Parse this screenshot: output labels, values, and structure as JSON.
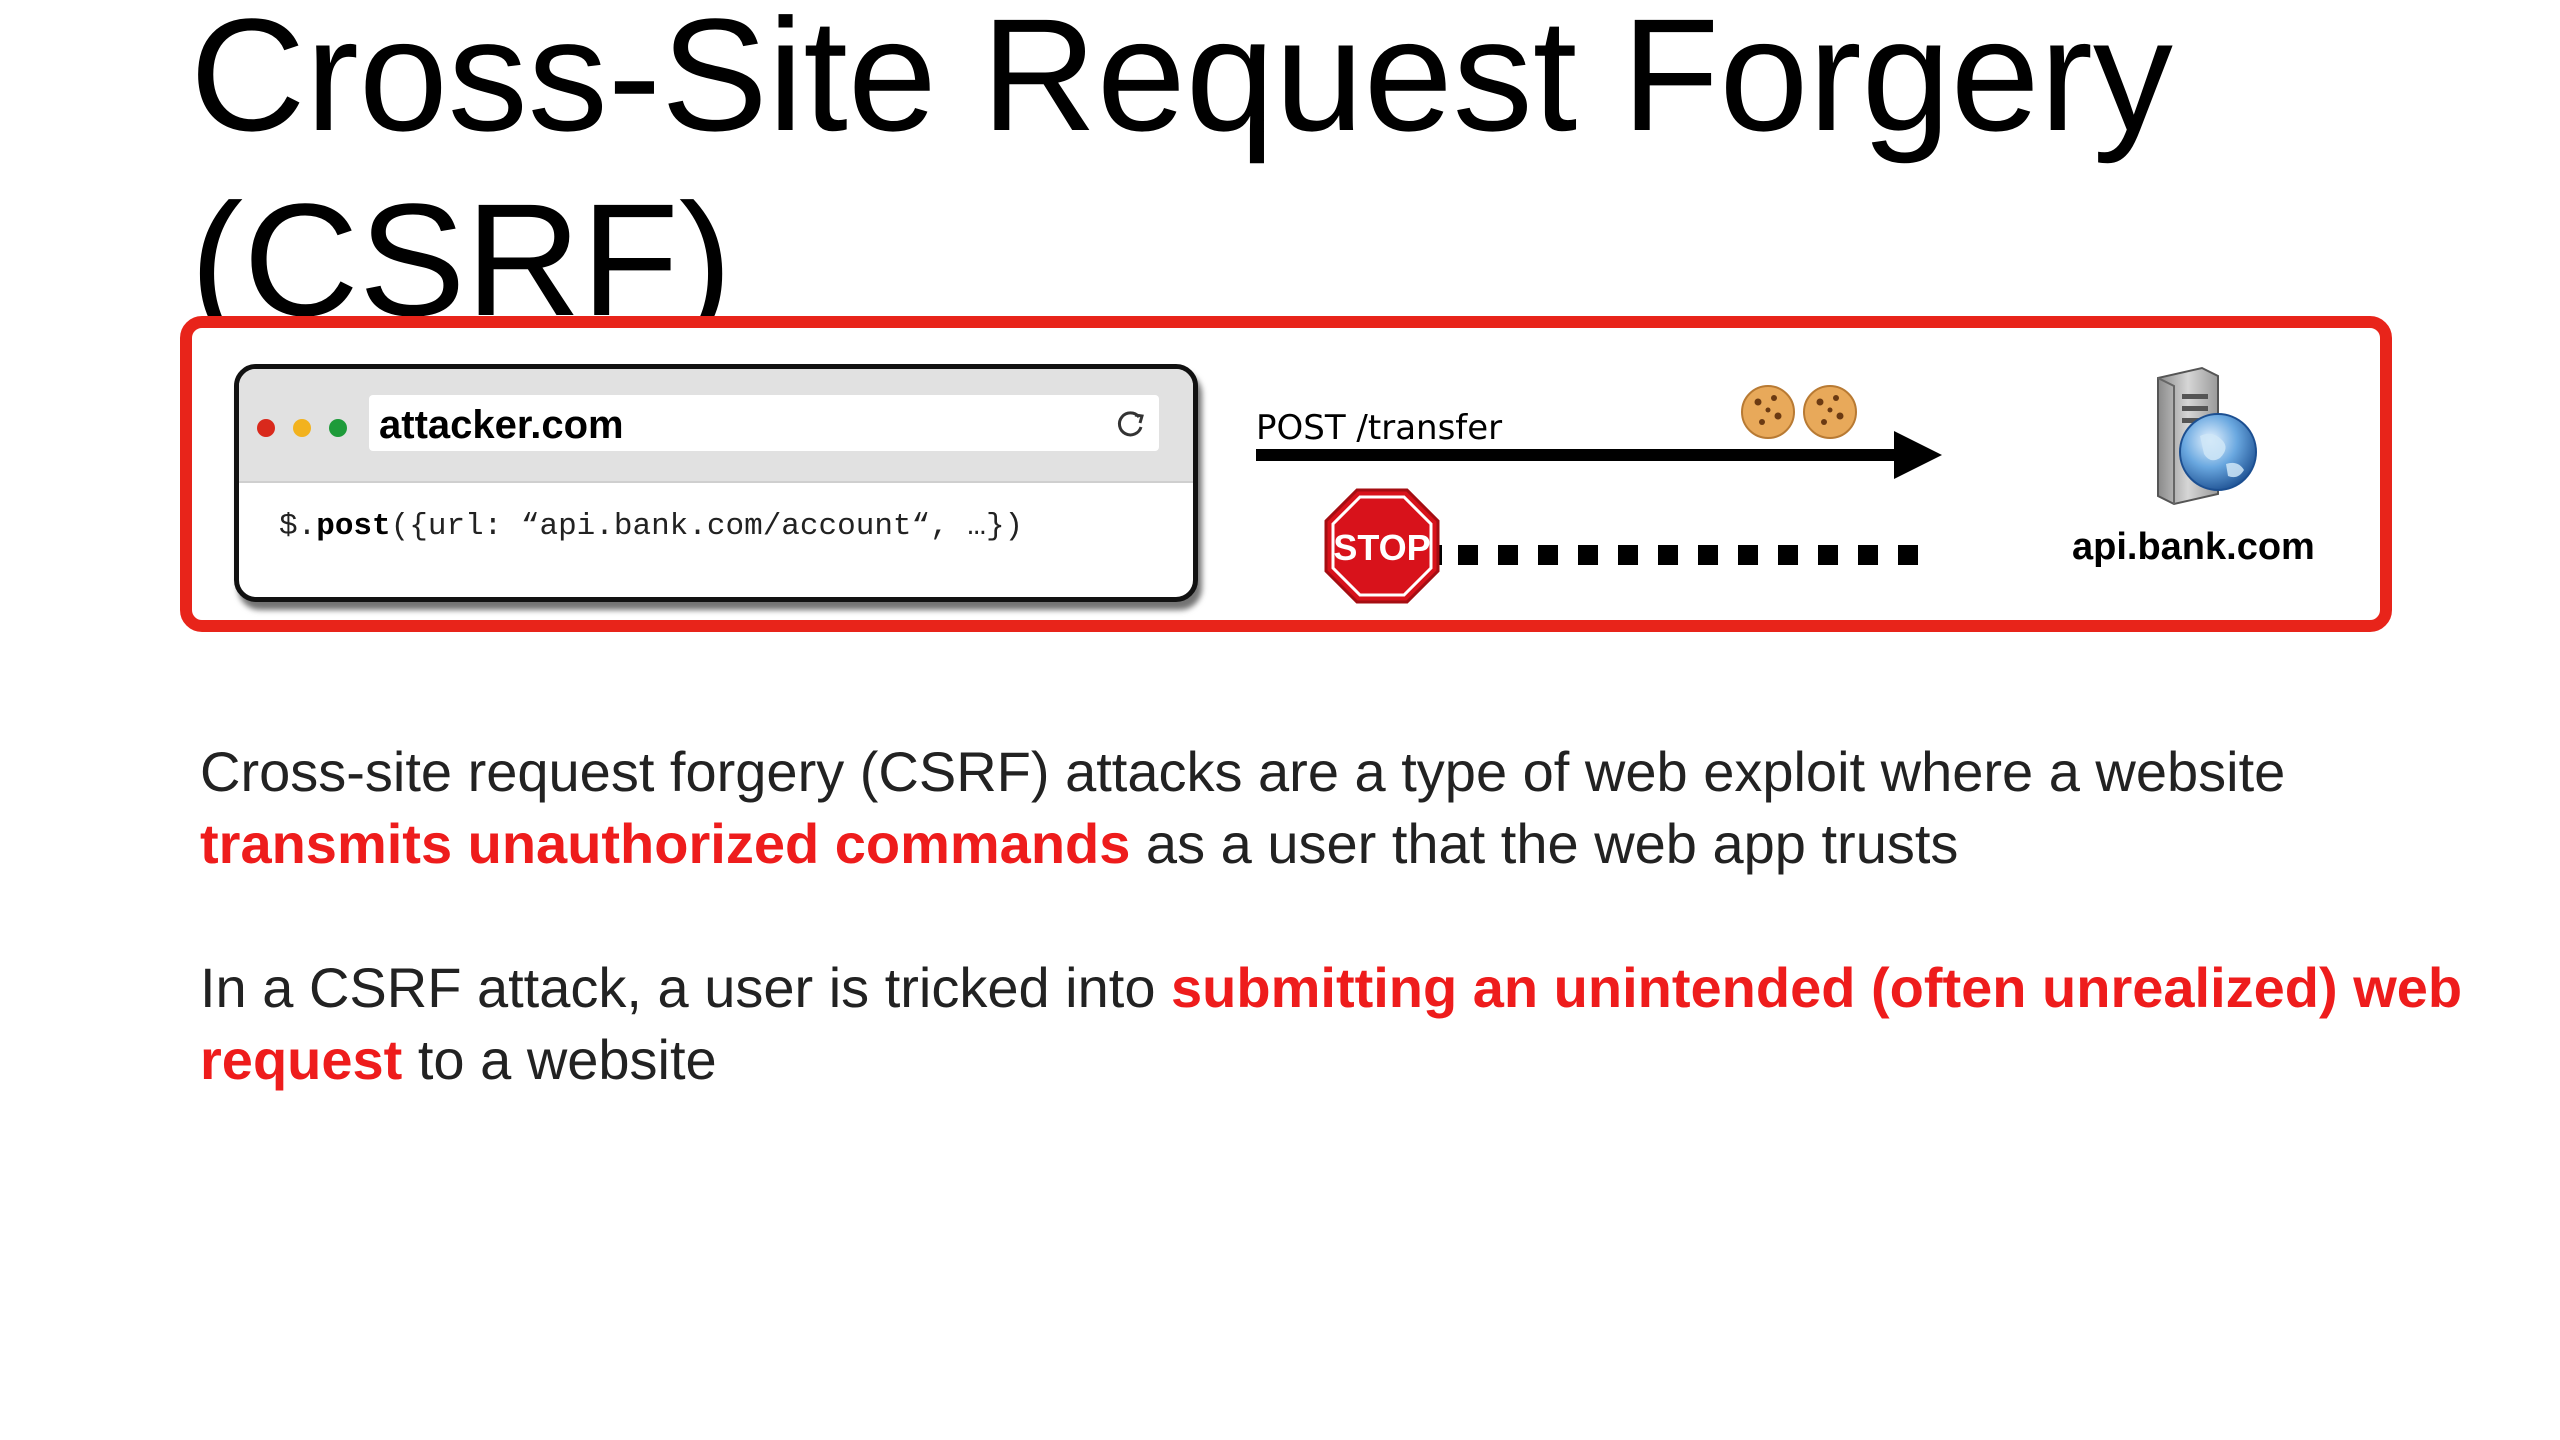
{
  "slide": {
    "title_line1": "Cross-Site Request Forgery",
    "title_line2": "(CSRF)"
  },
  "diagram": {
    "frame_color": "#e8241a",
    "browser": {
      "address": "attacker.com",
      "code_prefix": "$.",
      "code_bold": "post",
      "code_rest": "({url: “api.bank.com/account“, …})"
    },
    "request_label": "POST /transfer",
    "stop_sign_text": "STOP",
    "server_label": "api.bank.com"
  },
  "paragraph1": {
    "part1": "Cross-site request forgery (CSRF) attacks are a type of web exploit where a website ",
    "highlight": "transmits unauthorized commands",
    "part2": " as a user that the web app trusts"
  },
  "paragraph2": {
    "part1": "In a CSRF attack, a user is tricked into ",
    "highlight": "submitting an unintended (often unrealized) web request",
    "part2": " to a website"
  },
  "colors": {
    "highlight": "#ee1c1c",
    "body_text": "#222222"
  }
}
